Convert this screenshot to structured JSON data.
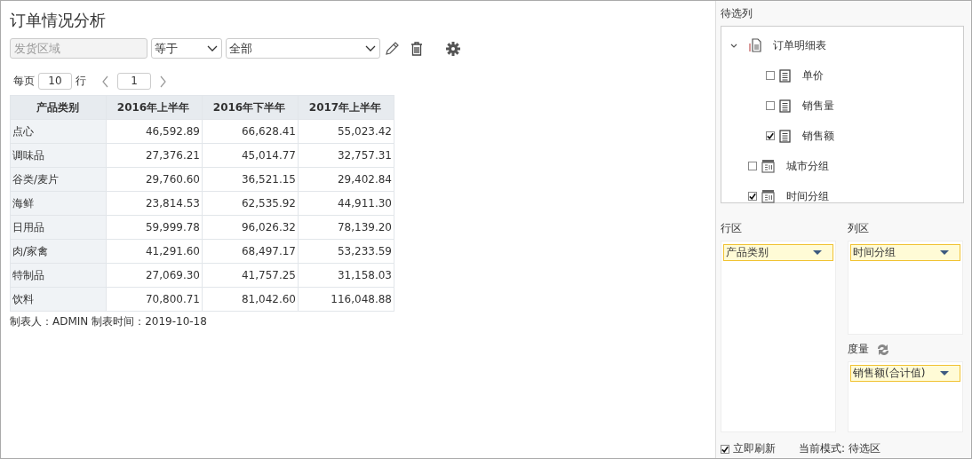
{
  "title": "订单情况分析",
  "filter": {
    "field_placeholder": "发货区域",
    "operator": "等于",
    "value": "全部"
  },
  "pagination": {
    "label_before": "每页",
    "page_size": "10",
    "label_after": "行",
    "page": "1"
  },
  "table": {
    "columns": [
      "产品类别",
      "2016年上半年",
      "2016年下半年",
      "2017年上半年"
    ],
    "rows": [
      [
        "点心",
        "46,592.89",
        "66,628.41",
        "55,023.42"
      ],
      [
        "调味品",
        "27,376.21",
        "45,014.77",
        "32,757.31"
      ],
      [
        "谷类/麦片",
        "29,760.60",
        "36,521.15",
        "29,402.84"
      ],
      [
        "海鲜",
        "23,814.53",
        "62,535.92",
        "44,911.30"
      ],
      [
        "日用品",
        "59,999.78",
        "96,026.32",
        "78,139.20"
      ],
      [
        "肉/家禽",
        "41,291.60",
        "68,497.17",
        "53,233.59"
      ],
      [
        "特制品",
        "27,069.30",
        "41,757.25",
        "31,158.03"
      ],
      [
        "饮料",
        "70,800.71",
        "81,042.60",
        "116,048.88"
      ]
    ]
  },
  "footer": "制表人：ADMIN  制表时间：2019-10-18",
  "field_list": {
    "title": "待选列",
    "tree": [
      {
        "label": "订单明细表",
        "kind": "table",
        "expanded": true,
        "children": [
          {
            "label": "单价",
            "kind": "field",
            "checked": false
          },
          {
            "label": "销售量",
            "kind": "field",
            "checked": false
          },
          {
            "label": "销售额",
            "kind": "field",
            "checked": true
          }
        ]
      },
      {
        "label": "城市分组",
        "kind": "group",
        "checked": false
      },
      {
        "label": "时间分组",
        "kind": "group",
        "checked": true
      }
    ]
  },
  "row_zone": {
    "title": "行区",
    "items": [
      "产品类别"
    ]
  },
  "column_zone": {
    "title": "列区",
    "items": [
      "时间分组"
    ]
  },
  "measure_zone": {
    "title": "度量",
    "items": [
      "销售额(合计值)"
    ]
  },
  "auto_refresh": {
    "label": "立即刷新",
    "checked": true
  },
  "mode": "当前模式: 待选区"
}
